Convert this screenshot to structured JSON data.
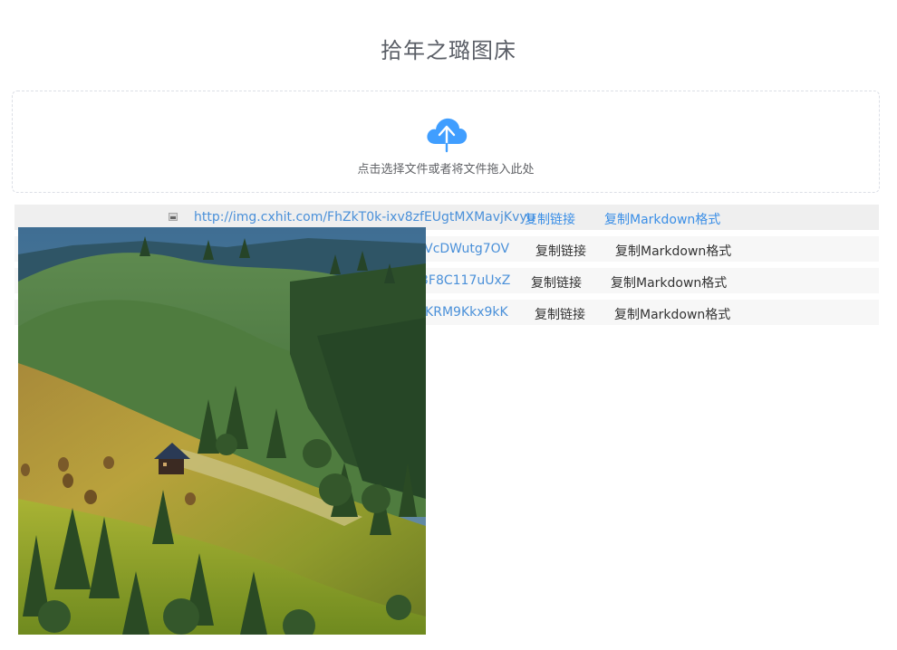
{
  "header": {
    "title": "拾年之璐图床"
  },
  "upload": {
    "hint": "点击选择文件或者将文件拖入此处",
    "icon": "cloud-upload-icon",
    "icon_color": "#409eff"
  },
  "files": [
    {
      "url": "http://img.cxhit.com/FhZkT0k-ixv8zfEUgtMXMavjKvyu",
      "copy_link": "复制链接",
      "copy_markdown": "复制Markdown格式"
    },
    {
      "url": "JVcDWutg7OV",
      "copy_link": "复制链接",
      "copy_markdown": "复制Markdown格式"
    },
    {
      "url": "3F8C117uUxZ",
      "copy_link": "复制链接",
      "copy_markdown": "复制Markdown格式"
    },
    {
      "url": "-KRM9Kkx9kK",
      "copy_link": "复制链接",
      "copy_markdown": "复制Markdown格式"
    }
  ],
  "preview": {
    "subject": "mountain-meadow-cabin-photo"
  },
  "colors": {
    "link": "#4a90d9",
    "title": "#5a5e66",
    "row_bg": "#f7f7f7",
    "row_hover_bg": "#efefef"
  }
}
